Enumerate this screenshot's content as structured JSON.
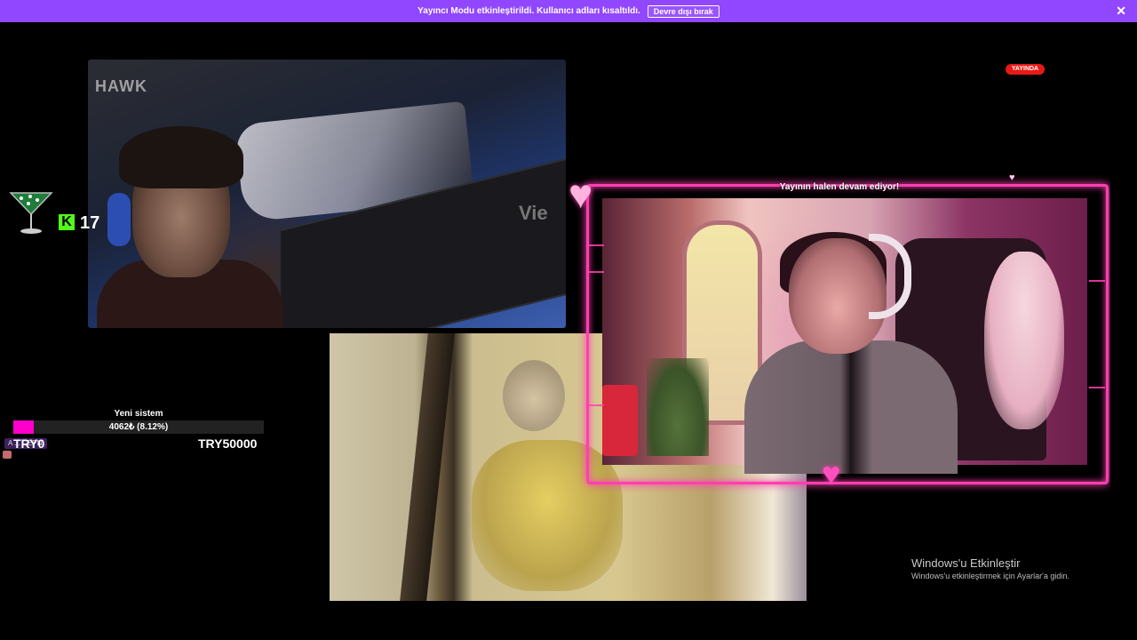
{
  "banner": {
    "message": "Yayıncı Modu etkinleştirildi. Kullanıcı adları kısaltıldı.",
    "disable_button": "Devre dışı bırak",
    "close_icon": "close-icon",
    "background": "#9146ff"
  },
  "live_badge": "YAYINDA",
  "cameras": {
    "cam1": {
      "logo": "HAWK",
      "monitor_text": "Vie"
    },
    "cam3": {
      "caption": "Yayının halen devam ediyor!"
    }
  },
  "kick_widget": {
    "icon": "martini-icon",
    "badge": "K",
    "count": "17",
    "accent": "#53fc18"
  },
  "donation_goal": {
    "title": "Yeni sistem",
    "amount_text": "4062₺ (8.12%)",
    "progress": 0.0812,
    "min_label": "TRY0",
    "max_label": "TRY50000",
    "fill_color": "#ff00cc"
  },
  "chat": {
    "chip_text": "A ... CEPNI"
  },
  "windows_watermark": {
    "title": "Windows'u Etkinleştir",
    "subtitle": "Windows'u etkinleştirmek için Ayarlar'a gidin."
  }
}
